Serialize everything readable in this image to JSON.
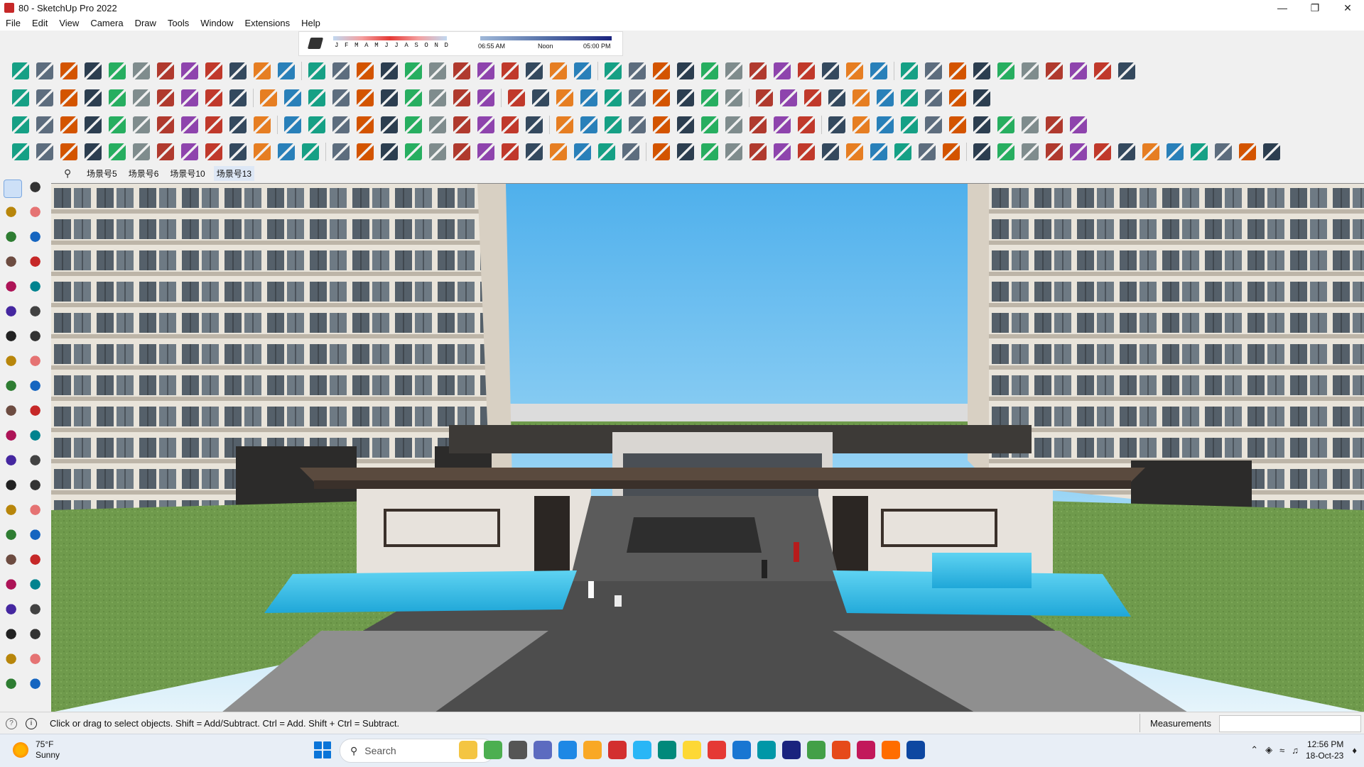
{
  "window": {
    "title": "80 - SketchUp Pro 2022",
    "controls": [
      "minimize",
      "restore",
      "close"
    ]
  },
  "menu": [
    "File",
    "Edit",
    "View",
    "Camera",
    "Draw",
    "Tools",
    "Window",
    "Extensions",
    "Help"
  ],
  "shadow": {
    "months": [
      "J",
      "F",
      "M",
      "A",
      "M",
      "J",
      "J",
      "A",
      "S",
      "O",
      "N",
      "D"
    ],
    "time_start": "06:55 AM",
    "time_mid": "Noon",
    "time_end": "05:00 PM"
  },
  "scenes": {
    "tabs": [
      "场景号5",
      "场景号6",
      "场景号10",
      "场景号13"
    ]
  },
  "status": {
    "message": "Click or drag to select objects. Shift = Add/Subtract. Ctrl = Add. Shift + Ctrl = Subtract.",
    "measurements_label": "Measurements",
    "measurements_value": ""
  },
  "taskbar": {
    "weather_temp": "75°F",
    "weather_desc": "Sunny",
    "search_placeholder": "Search",
    "time": "12:56 PM",
    "date": "18-Oct-23"
  },
  "colors": {
    "accent": "#0a74d8",
    "sky": "#9fd3f5",
    "water": "#3ec1e8",
    "grass": "#6e9a4e"
  }
}
